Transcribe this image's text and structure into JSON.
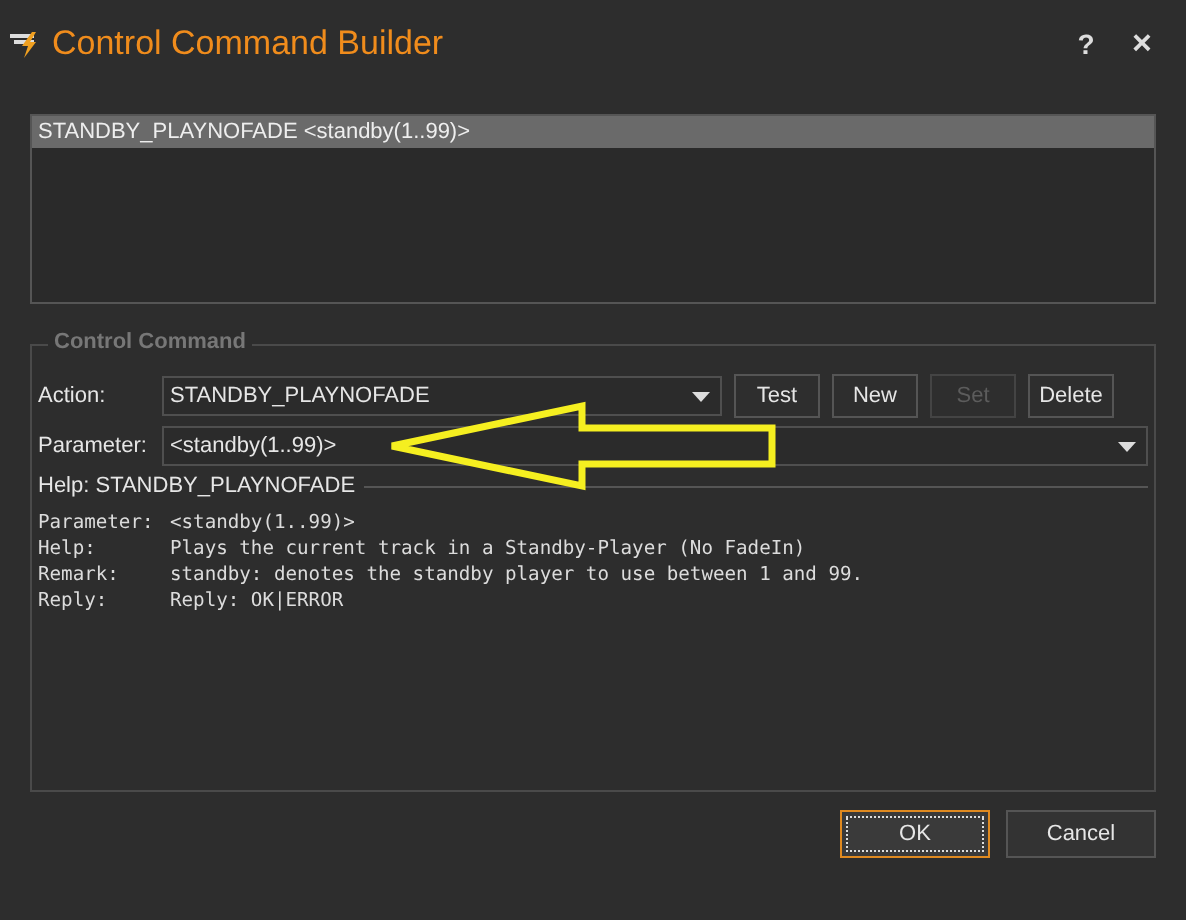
{
  "window": {
    "title": "Control Command Builder",
    "help_button": "?",
    "close_button": "×"
  },
  "command_list": [
    {
      "text": "STANDBY_PLAYNOFADE <standby(1..99)>",
      "selected": true
    }
  ],
  "group": {
    "title": "Control Command",
    "action": {
      "label": "Action:",
      "value": "STANDBY_PLAYNOFADE"
    },
    "buttons": [
      {
        "label": "Test",
        "disabled": false
      },
      {
        "label": "New",
        "disabled": false
      },
      {
        "label": "Set",
        "disabled": true
      },
      {
        "label": "Delete",
        "disabled": false
      }
    ],
    "parameter": {
      "label": "Parameter:",
      "value": "<standby(1..99)>"
    },
    "help_title": "Help: STANDBY_PLAYNOFADE",
    "help_lines": [
      {
        "label": "Parameter:",
        "text": "<standby(1..99)>"
      },
      {
        "label": "Help:",
        "text": "Plays the current track in a Standby-Player (No FadeIn)"
      },
      {
        "label": "Remark:",
        "text": "standby: denotes the standby player to use between 1 and 99."
      },
      {
        "label": "Reply:",
        "text": "Reply: OK|ERROR"
      }
    ]
  },
  "annotation": {
    "kind": "arrow"
  },
  "dialog_buttons": [
    {
      "label": "OK",
      "default": true
    },
    {
      "label": "Cancel",
      "default": false
    }
  ]
}
